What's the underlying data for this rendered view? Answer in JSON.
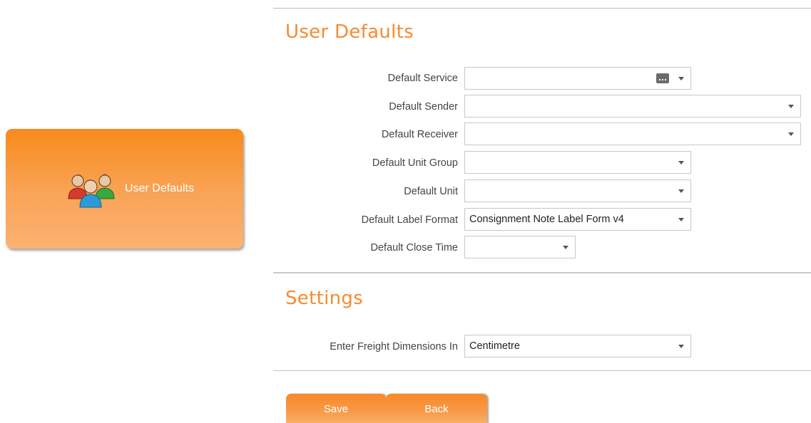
{
  "side_tile": {
    "label": "User Defaults",
    "icon": "users-icon"
  },
  "user_defaults": {
    "title": "User Defaults",
    "fields": [
      {
        "label": "Default Service",
        "value": ""
      },
      {
        "label": "Default Sender",
        "value": ""
      },
      {
        "label": "Default Receiver",
        "value": ""
      },
      {
        "label": "Default Unit Group",
        "value": ""
      },
      {
        "label": "Default Unit",
        "value": ""
      },
      {
        "label": "Default Label Format",
        "value": "Consignment Note Label Form v4"
      },
      {
        "label": "Default Close Time",
        "value": ""
      }
    ]
  },
  "settings": {
    "title": "Settings",
    "fields": [
      {
        "label": "Enter Freight Dimensions In",
        "value": "Centimetre"
      }
    ]
  },
  "actions": {
    "save_label": "Save",
    "back_label": "Back"
  },
  "colors": {
    "accent": "#f68b33",
    "button": "#f7892a"
  }
}
